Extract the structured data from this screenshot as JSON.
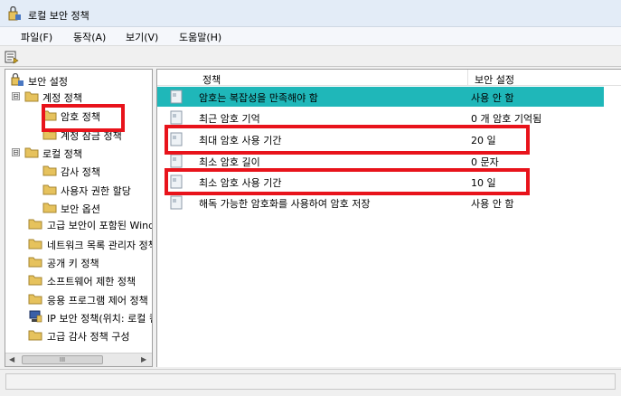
{
  "window": {
    "title": "로컬 보안 정책"
  },
  "menu": [
    {
      "label": "파일(F)"
    },
    {
      "label": "동작(A)"
    },
    {
      "label": "보기(V)"
    },
    {
      "label": "도움말(H)"
    }
  ],
  "tree": {
    "items": [
      {
        "label": "보안 설정"
      },
      {
        "label": "계정 정책",
        "expander": "⊟"
      },
      {
        "label": "암호 정책"
      },
      {
        "label": "계정 잠금 정책"
      },
      {
        "label": "로컬 정책",
        "expander": "⊟"
      },
      {
        "label": "감사 정책"
      },
      {
        "label": "사용자 권한 할당"
      },
      {
        "label": "보안 옵션"
      },
      {
        "label": "고급 보안이 포함된 Windows 방화벽"
      },
      {
        "label": "네트워크 목록 관리자 정책"
      },
      {
        "label": "공개 키 정책"
      },
      {
        "label": "소프트웨어 제한 정책"
      },
      {
        "label": "응용 프로그램 제어 정책"
      },
      {
        "label": "IP 보안 정책(위치: 로컬 컴퓨터)"
      },
      {
        "label": "고급 감사 정책 구성"
      }
    ],
    "scroll_thumb": "III"
  },
  "list": {
    "columns": {
      "policy": "정책",
      "setting": "보안 설정"
    },
    "rows": [
      {
        "policy": "암호는 복잡성을 만족해야 함",
        "setting": "사용 안 함"
      },
      {
        "policy": "최근 암호 기억",
        "setting": "0 개 암호 기억됨"
      },
      {
        "policy": "최대 암호 사용 기간",
        "setting": "20 일"
      },
      {
        "policy": "최소 암호 길이",
        "setting": "0 문자"
      },
      {
        "policy": "최소 암호 사용 기간",
        "setting": "10 일"
      },
      {
        "policy": "해독 가능한 암호화를 사용하여 암호 저장",
        "setting": "사용 안 함"
      }
    ]
  },
  "colors": {
    "selection": "#1fb7b9",
    "highlight_box": "#e8131b",
    "folder": "#e6c25d"
  }
}
